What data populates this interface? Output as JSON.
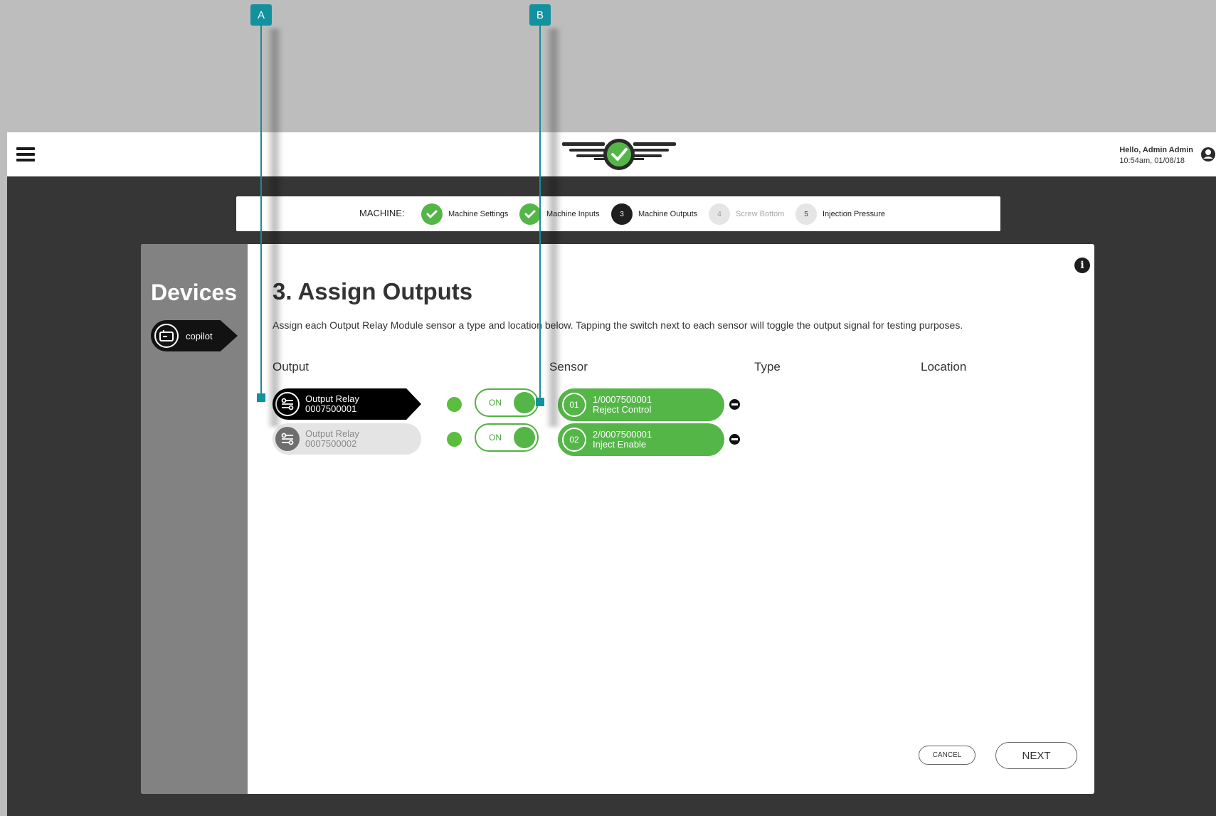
{
  "callouts": [
    {
      "label": "A"
    },
    {
      "label": "B"
    }
  ],
  "header": {
    "greeting": "Hello, Admin Admin",
    "timestamp": "10:54am, 01/08/18"
  },
  "stepper": {
    "prefix": "MACHINE:",
    "steps": [
      {
        "number": "",
        "label": "Machine Settings",
        "state": "done"
      },
      {
        "number": "",
        "label": "Machine Inputs",
        "state": "done"
      },
      {
        "number": "3",
        "label": "Machine Outputs",
        "state": "active"
      },
      {
        "number": "4",
        "label": "Screw Bottom",
        "state": "disabled"
      },
      {
        "number": "5",
        "label": "Injection Pressure",
        "state": "pending"
      }
    ]
  },
  "sidebar": {
    "title": "Devices",
    "device": {
      "label": "copilot"
    }
  },
  "main": {
    "title": "3. Assign Outputs",
    "description": "Assign each Output Relay Module sensor a type and location below. Tapping the switch next to each sensor will toggle the output signal for testing purposes.",
    "columns": {
      "output": "Output",
      "sensor": "Sensor",
      "type": "Type",
      "location": "Location"
    },
    "rows": [
      {
        "relay_name": "Output Relay",
        "relay_id": "0007500001",
        "relay_selected": true,
        "toggle_label": "ON",
        "sensor_number": "01",
        "sensor_id": "1/0007500001",
        "sensor_type": "Reject Control"
      },
      {
        "relay_name": "Output Relay",
        "relay_id": "0007500002",
        "relay_selected": false,
        "toggle_label": "ON",
        "sensor_number": "02",
        "sensor_id": "2/0007500001",
        "sensor_type": "Inject Enable"
      }
    ]
  },
  "footer": {
    "cancel_label": "CANCEL",
    "next_label": "NEXT"
  },
  "colors": {
    "accent_green": "#55b648",
    "callout_teal": "#14919f",
    "background_dark": "#363636"
  }
}
